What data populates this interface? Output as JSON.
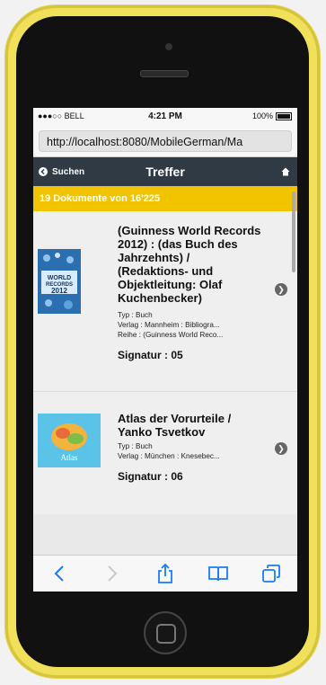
{
  "status": {
    "carrier": "●●●○○ BELL",
    "time": "4:21 PM",
    "battery": "100%"
  },
  "browser": {
    "url": "http://localhost:8080/MobileGerman/Ma"
  },
  "navbar": {
    "back_label": "Suchen",
    "title": "Treffer"
  },
  "results": {
    "count_text": "19 Dokumente von 16'225"
  },
  "items": [
    {
      "title": "(Guinness World Records 2012) : (das Buch des Jahrzehnts) / (Redaktions- und Objektleitung: Olaf Kuchenbecker)",
      "typ": "Typ : Buch",
      "verlag": "Verlag : Mannheim : Bibliogra...",
      "reihe": "Reihe : (Guinness World Reco...",
      "signatur": "Signatur : 05",
      "thumb_text": "WORLD RECORDS 2012"
    },
    {
      "title": "Atlas der Vorurteile / Yanko Tsvetkov",
      "typ": "Typ : Buch",
      "verlag": "Verlag : München : Knesebec...",
      "signatur": "Signatur : 06",
      "thumb_text": "Atlas"
    }
  ],
  "colors": {
    "accent": "#f2c400",
    "navbar": "#2f3a45",
    "phone": "#f0e05a"
  },
  "icons": [
    "back-chevron-icon",
    "home-icon",
    "chevron-right-icon",
    "share-icon",
    "bookmarks-icon",
    "tabs-icon"
  ]
}
